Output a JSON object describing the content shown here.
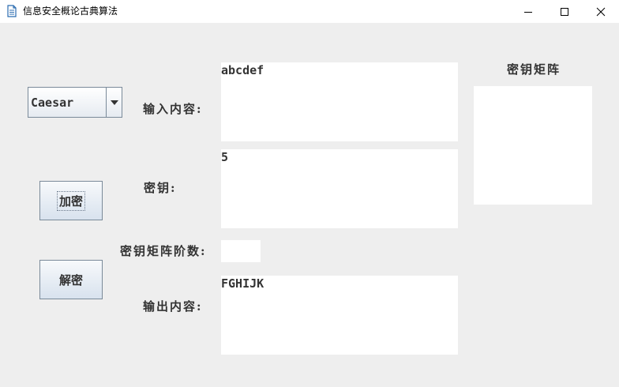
{
  "window": {
    "title": "信息安全概论古典算法",
    "icon": "document-icon",
    "controls": [
      "minimize-icon",
      "maximize-icon",
      "close-icon"
    ]
  },
  "algorithm_select": {
    "value": "Caesar"
  },
  "buttons": {
    "encrypt": "加密",
    "decrypt": "解密"
  },
  "labels": {
    "input": "输入内容:",
    "key": "密钥:",
    "matrix_order": "密钥矩阵阶数:",
    "output": "输出内容:",
    "key_matrix": "密钥矩阵"
  },
  "fields": {
    "input": "abcdef",
    "key": "5",
    "matrix_order": "",
    "output": "FGHIJK",
    "key_matrix": ""
  },
  "colors": {
    "background": "#eeeeee",
    "field": "#ffffff",
    "text": "#333333"
  }
}
